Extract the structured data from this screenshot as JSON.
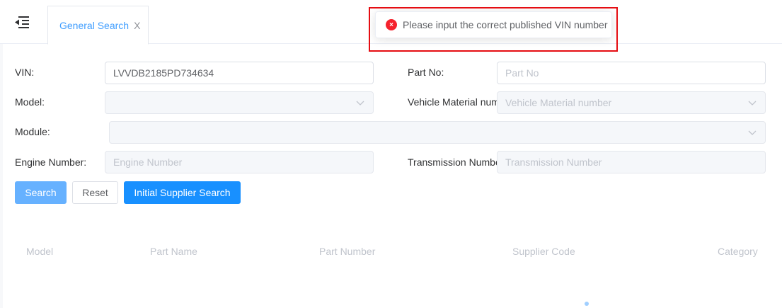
{
  "tabs": [
    {
      "label": "General Search",
      "close": "X"
    }
  ],
  "message": {
    "type": "error",
    "icon": "error-circle-icon",
    "icon_glyph": "×",
    "text": "Please input the correct published VIN number"
  },
  "form": {
    "vin": {
      "label": "VIN:",
      "value": "LVVDB2185PD734634"
    },
    "part_no": {
      "label": "Part No:",
      "placeholder": "Part No"
    },
    "model": {
      "label": "Model:",
      "value": ""
    },
    "vehicle_material_number": {
      "label": "Vehicle Material number",
      "placeholder": "Vehicle Material number"
    },
    "module": {
      "label": "Module:",
      "value": ""
    },
    "engine_number": {
      "label": "Engine Number:",
      "placeholder": "Engine Number"
    },
    "transmission_number": {
      "label": "Transmission Number",
      "placeholder": "Transmission Number"
    }
  },
  "buttons": {
    "search": "Search",
    "reset": "Reset",
    "initial_supplier_search": "Initial Supplier Search"
  },
  "table": {
    "columns": [
      "Model",
      "Part Name",
      "Part Number",
      "Supplier Code",
      "Category"
    ]
  },
  "colors": {
    "primary": "#1890ff",
    "primary_light": "#66b1ff",
    "error": "#f5222d",
    "annotation_box": "#e50d12"
  }
}
